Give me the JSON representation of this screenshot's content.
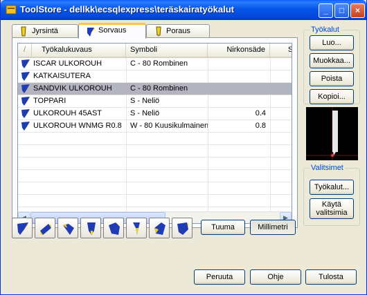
{
  "window": {
    "title": "ToolStore - dellkk\\ecsqlexpress\\teräskairatyökalut",
    "minimize": "_",
    "maximize": "□",
    "close": "×"
  },
  "tabs": [
    {
      "label": "Jyrsintä"
    },
    {
      "label": "Sorvaus"
    },
    {
      "label": "Poraus"
    }
  ],
  "list": {
    "columns": [
      "Työkalukuvaus",
      "Symboli",
      "Nirkonsäde",
      "S"
    ],
    "rows": [
      {
        "desc": "ISCAR ULKOROUH",
        "symbol": "C - 80 Rombinen",
        "radius": ""
      },
      {
        "desc": "KATKAISUTERA",
        "symbol": "",
        "radius": ""
      },
      {
        "desc": "SANDVIK ULKOROUH",
        "symbol": "C - 80 Rombinen",
        "radius": "",
        "selected": true
      },
      {
        "desc": "TOPPARI",
        "symbol": "S - Neliö",
        "radius": ""
      },
      {
        "desc": "ULKOROUH 45AST",
        "symbol": "S - Neliö",
        "radius": "0.4"
      },
      {
        "desc": "ULKOROUH WNMG R0.8",
        "symbol": "W - 80 Kuusikulmainen",
        "radius": "0.8"
      }
    ],
    "scroll_left": "◀",
    "scroll_right": "▶"
  },
  "tyokalut_group": {
    "title": "Työkalut",
    "new": "Luo...",
    "edit": "Muokkaa...",
    "delete": "Poista",
    "copy": "Kopioi..."
  },
  "valitsimet_group": {
    "title": "Valitsimet",
    "tools": "Työkalut...",
    "use_line1": "Käytä",
    "use_line2": "valitsimia"
  },
  "units": {
    "inch": "Tuuma",
    "mm": "Millimetri"
  },
  "footer": {
    "cancel": "Peruuta",
    "help": "Ohje",
    "print": "Tulosta"
  },
  "colors": {
    "accent": "#0046d5",
    "selection": "#b4b4c0",
    "tool_blue": "#1f3cb4",
    "tool_yellow": "#f0d020"
  }
}
